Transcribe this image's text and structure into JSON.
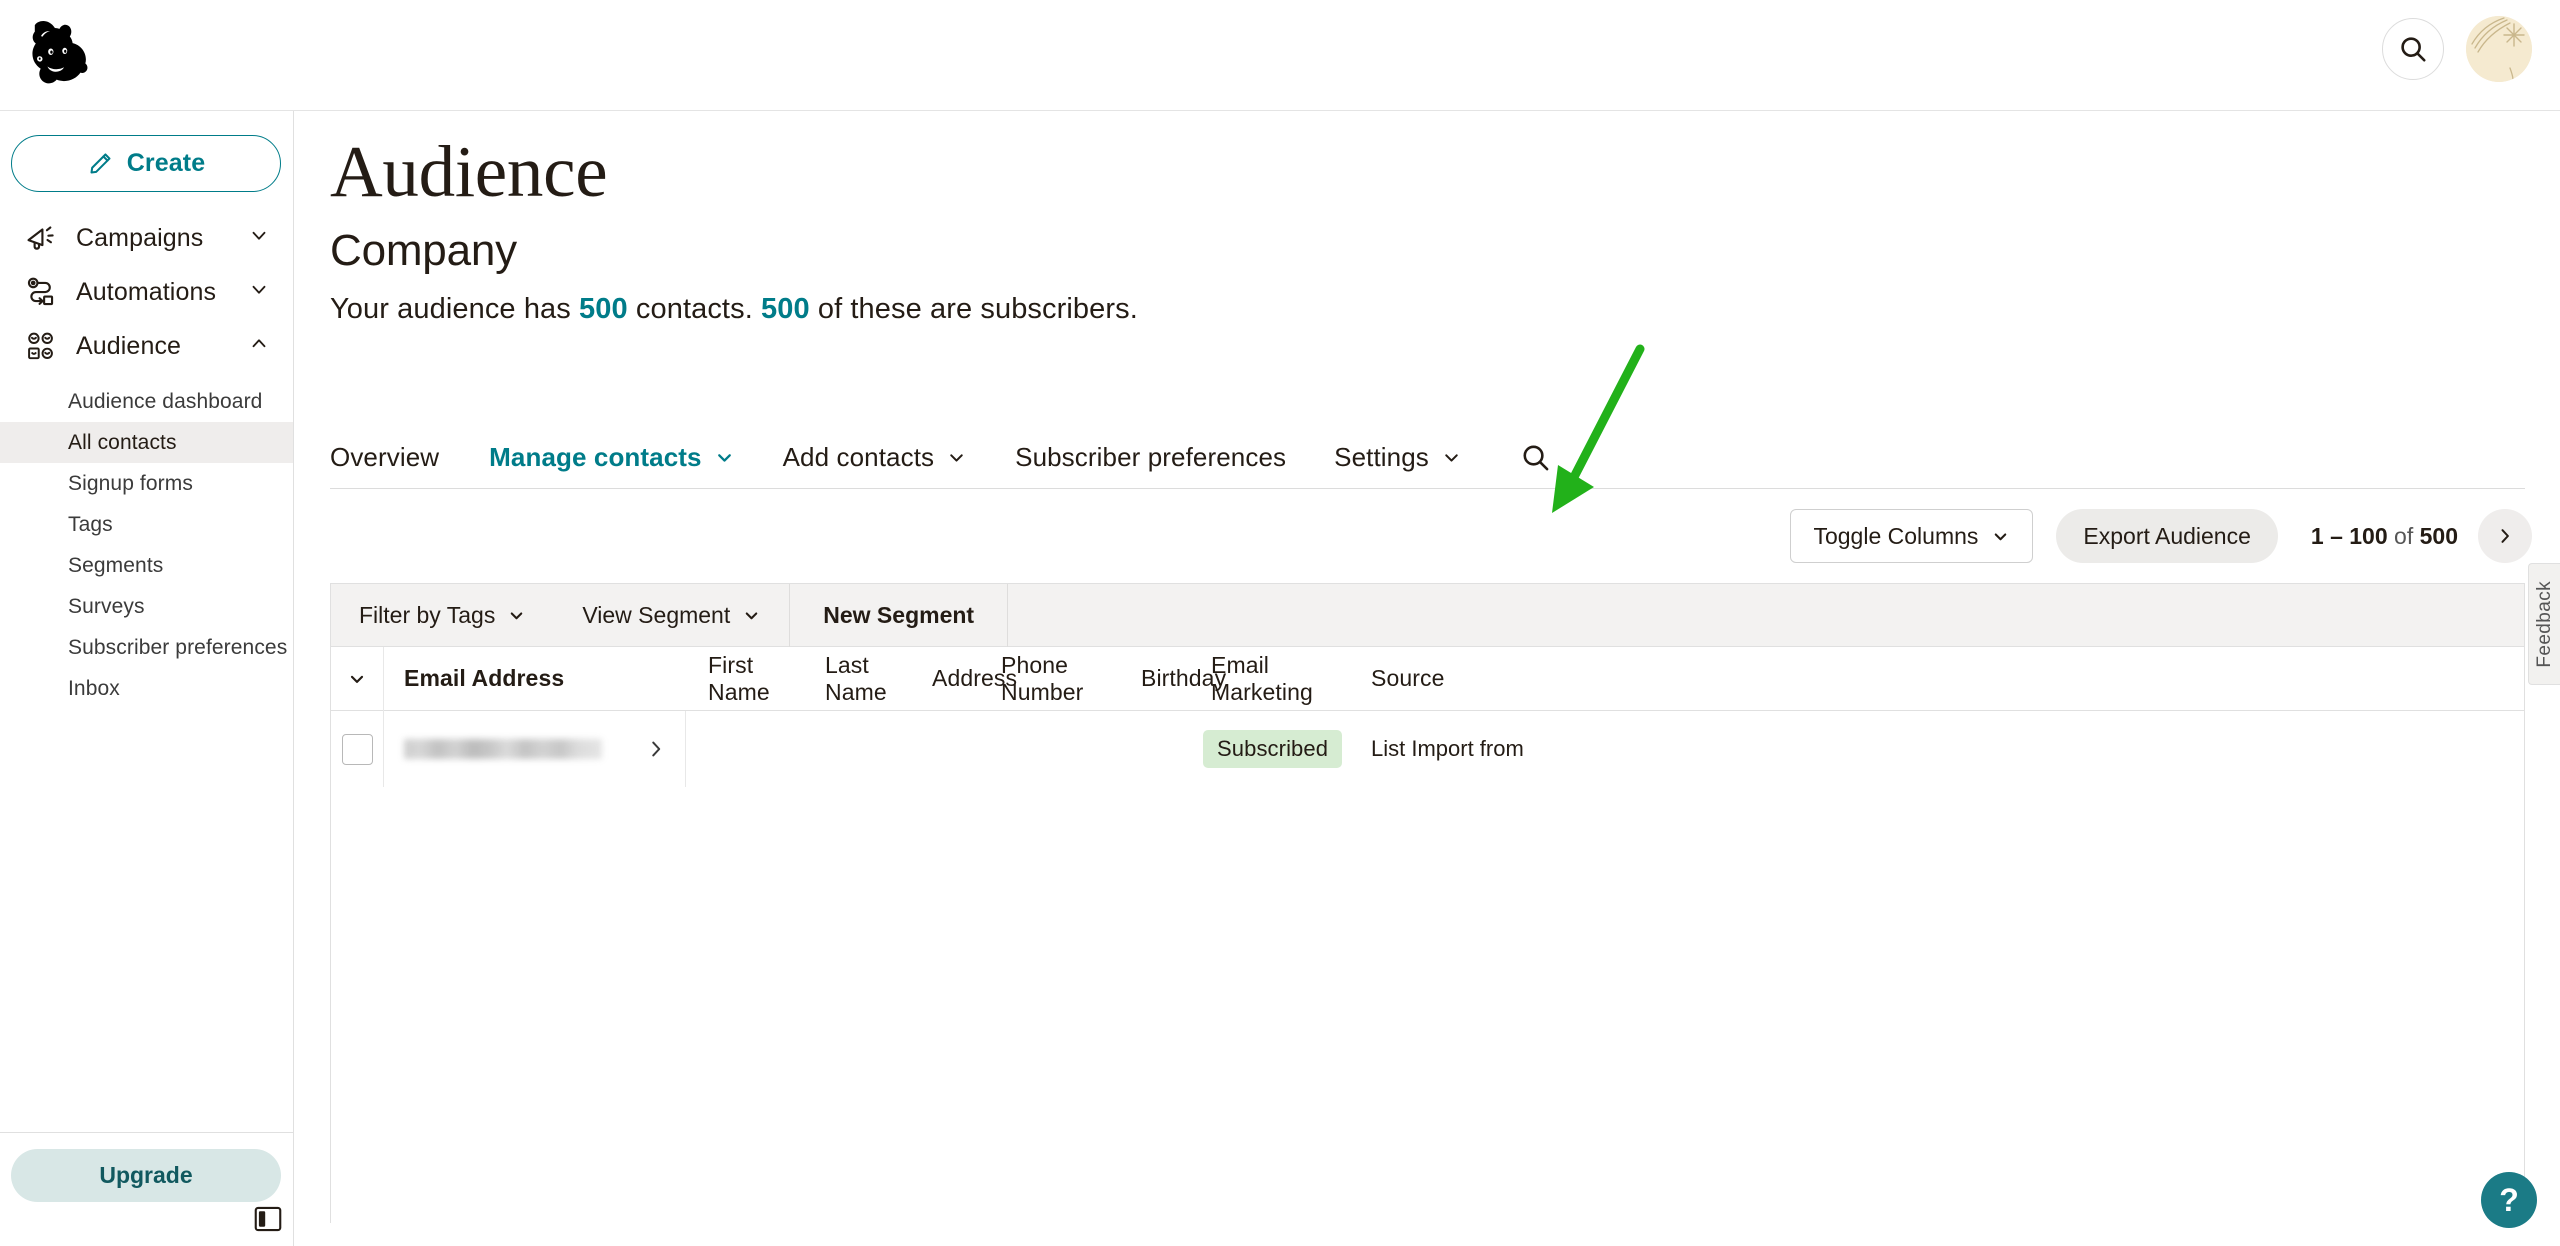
{
  "topbar": {
    "logo_name": "mailchimp-freddie-logo",
    "search_icon": "search-icon",
    "avatar_label": "user-avatar"
  },
  "sidebar": {
    "create_label": "Create",
    "create_icon": "pencil-icon",
    "groups": [
      {
        "label": "Campaigns",
        "icon": "megaphone-icon",
        "chevron": "chevron-down-icon"
      },
      {
        "label": "Automations",
        "icon": "automation-flow-icon",
        "chevron": "chevron-down-icon"
      },
      {
        "label": "Audience",
        "icon": "people-group-icon",
        "chevron": "chevron-up-icon"
      }
    ],
    "audience_items": [
      {
        "label": "Audience dashboard",
        "active": false
      },
      {
        "label": "All contacts",
        "active": true
      },
      {
        "label": "Signup forms",
        "active": false
      },
      {
        "label": "Tags",
        "active": false
      },
      {
        "label": "Segments",
        "active": false
      },
      {
        "label": "Surveys",
        "active": false
      },
      {
        "label": "Subscriber preferences",
        "active": false
      },
      {
        "label": "Inbox",
        "active": false
      }
    ],
    "upgrade_label": "Upgrade",
    "panel_toggle_icon": "sidebar-panel-toggle-icon"
  },
  "main": {
    "title": "Audience",
    "subtitle": "Company",
    "summary": {
      "part1": "Your audience has ",
      "count1": "500",
      "part2": " contacts. ",
      "count2": "500",
      "part3": " of these are subscribers."
    },
    "tabs": [
      {
        "label": "Overview",
        "has_chevron": false,
        "active": false
      },
      {
        "label": "Manage contacts",
        "has_chevron": true,
        "active": true
      },
      {
        "label": "Add contacts",
        "has_chevron": true,
        "active": false
      },
      {
        "label": "Subscriber preferences",
        "has_chevron": false,
        "active": false
      },
      {
        "label": "Settings",
        "has_chevron": true,
        "active": false
      }
    ],
    "tab_search_icon": "search-icon",
    "toolbar": {
      "toggle_columns_label": "Toggle Columns",
      "export_label": "Export Audience",
      "pager_range": "1 – 100",
      "pager_of": " of ",
      "pager_total": "500",
      "next_icon": "chevron-right-icon"
    },
    "filters": [
      {
        "label": "Filter by Tags",
        "has_chevron": true,
        "bold": false
      },
      {
        "label": "View Segment",
        "has_chevron": true,
        "bold": false
      },
      {
        "label": "New Segment",
        "has_chevron": false,
        "bold": true
      }
    ],
    "table": {
      "select_all_icon": "chevron-down-icon",
      "columns": [
        "Email Address",
        "First Name",
        "Last Name",
        "Address",
        "Phone Number",
        "Birthday",
        "Email Marketing",
        "Source"
      ],
      "rows": [
        {
          "email": "",
          "email_redacted": true,
          "expand_icon": "chevron-right-icon",
          "first_name": "",
          "last_name": "",
          "address": "",
          "phone": "",
          "birthday": "",
          "email_marketing": "Subscribed",
          "source": "List Import from"
        }
      ]
    }
  },
  "feedback": {
    "label": "Feedback"
  },
  "help": {
    "label": "?"
  },
  "colors": {
    "brand_teal": "#007c89",
    "upgrade_bg": "#d8e7e6",
    "badge_green": "#d6ecd2",
    "annotation_green": "#22b11a",
    "help_teal": "#1b7b86"
  }
}
